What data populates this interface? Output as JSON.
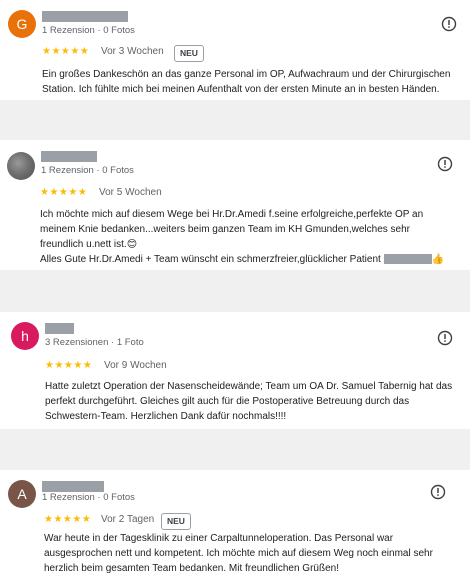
{
  "reviews": [
    {
      "avatar_letter": "G",
      "avatar_color": "#e8710a",
      "meta": "1 Rezension · 0 Fotos",
      "stars": "★★★★★",
      "date": "Vor 3 Wochen",
      "badge": "NEU",
      "text_lines": [
        "Ein großes Dankeschön an das ganze Personal im OP, Aufwachraum und der Chirurgischen",
        "Station. Ich fühlte mich bei meinen Aufenthalt von der ersten Minute an in besten Händen."
      ]
    },
    {
      "avatar_letter": "",
      "avatar_color": "#7a7a7a",
      "meta": "1 Rezension · 0 Fotos",
      "stars": "★★★★★",
      "date": "Vor 5 Wochen",
      "badge": "",
      "text_lines": [
        "Ich möchte mich auf diesem Wege bei Hr.Dr.Amedi f.seine erfolgreiche,perfekte OP an",
        "meinem Knie bedanken...weiters beim ganzen Team im KH Gmunden,welches sehr",
        "freundlich u.nett ist.😊",
        "Alles Gute Hr.Dr.Amedi + Team wünscht ein schmerzfreier,glücklicher Patient"
      ],
      "text_tail_emoji": "👍"
    },
    {
      "avatar_letter": "h",
      "avatar_color": "#d81b60",
      "meta": "3 Rezensionen · 1 Foto",
      "stars": "★★★★★",
      "date": "Vor 9 Wochen",
      "badge": "",
      "text_lines": [
        "Hatte zuletzt Operation der Nasenscheidewände; Team um OA Dr. Samuel Tabernig hat das",
        "perfekt durchgeführt. Gleiches gilt auch für die Postoperative Betreuung durch das",
        "Schwestern-Team. Herzlichen Dank dafür nochmals!!!!"
      ]
    },
    {
      "avatar_letter": "A",
      "avatar_color": "#795548",
      "meta": "1 Rezension · 0 Fotos",
      "stars": "★★★★★",
      "date": "Vor 2 Tagen",
      "badge": "NEU",
      "text_lines": [
        "War heute in der Tagesklinik zu einer Carpaltunneloperation. Das Personal war",
        "ausgesprochen nett und kompetent. Ich möchte mich auf diesem Weg noch einmal sehr",
        "herzlich beim gesamten Team bedanken. Mit freundlichen Grüßen!"
      ]
    }
  ],
  "icons": {
    "more": "info-icon"
  },
  "colors": {
    "star": "#fbbc04",
    "muted_text": "#5f6368",
    "redaction": "#9aa0a6"
  }
}
